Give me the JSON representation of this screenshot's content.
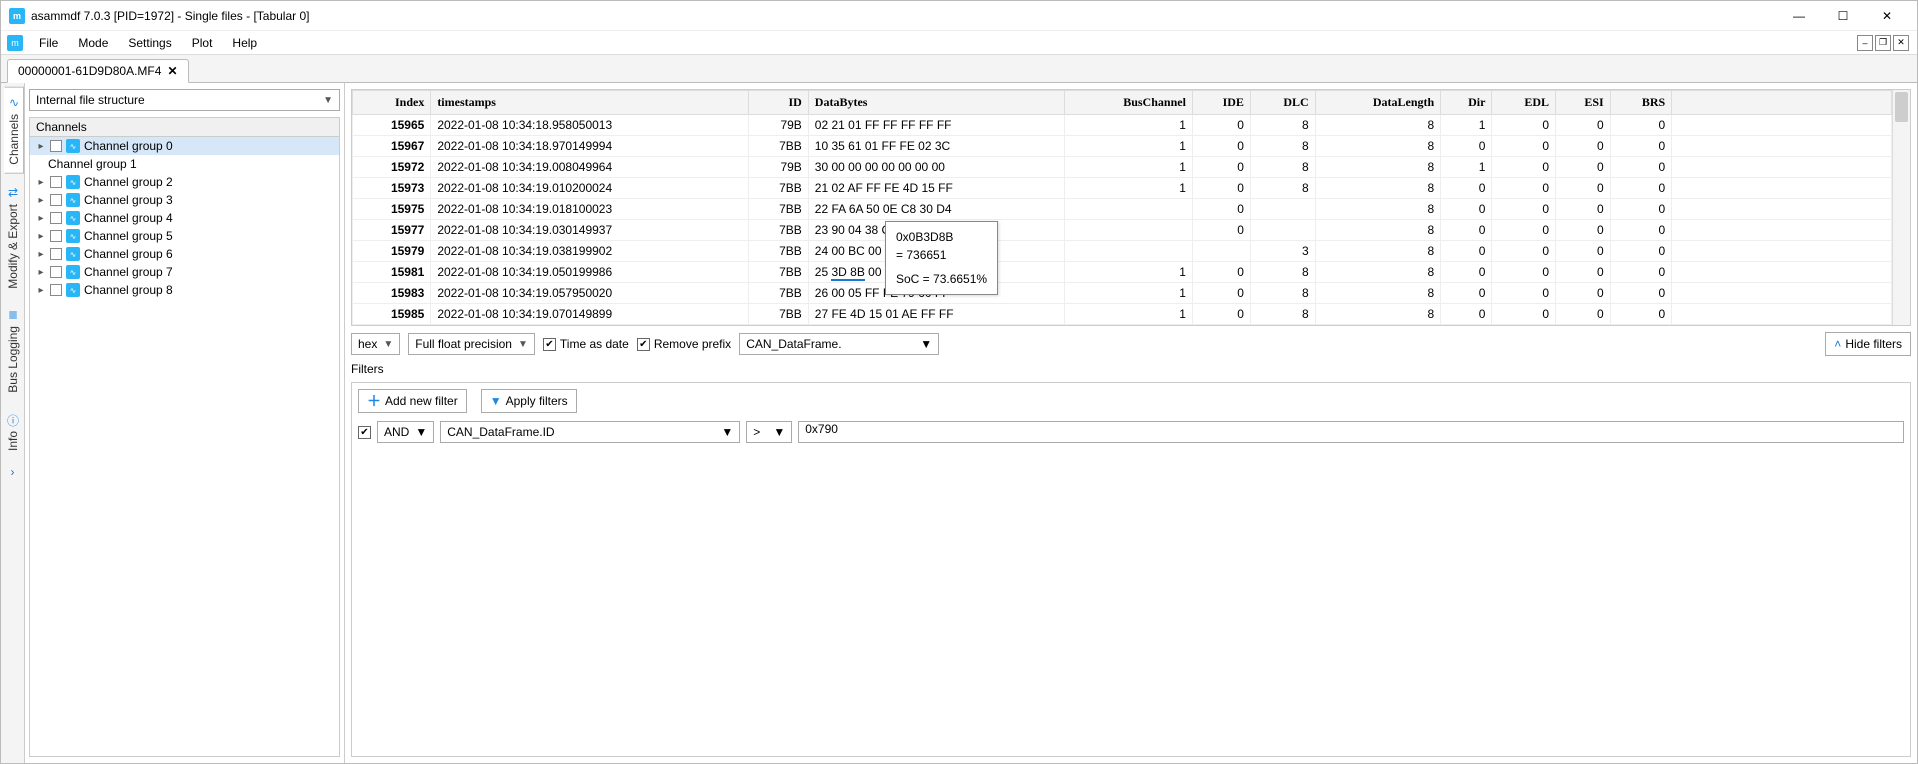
{
  "window": {
    "title": "asammdf 7.0.3 [PID=1972] - Single files - [Tabular 0]"
  },
  "menu": {
    "file": "File",
    "mode": "Mode",
    "settings": "Settings",
    "plot": "Plot",
    "help": "Help"
  },
  "filetab": {
    "name": "00000001-61D9D80A.MF4"
  },
  "sidetabs": {
    "channels": "Channels",
    "modify": "Modify & Export",
    "bus": "Bus Logging",
    "info": "Info"
  },
  "tree": {
    "combo": "Internal file structure",
    "header": "Channels",
    "groups": [
      "Channel group 0",
      "Channel group 1",
      "Channel group 2",
      "Channel group 3",
      "Channel group 4",
      "Channel group 5",
      "Channel group 6",
      "Channel group 7",
      "Channel group 8"
    ]
  },
  "table": {
    "headers": {
      "index": "Index",
      "timestamps": "timestamps",
      "id": "ID",
      "databytes": "DataBytes",
      "buschannel": "BusChannel",
      "ide": "IDE",
      "dlc": "DLC",
      "datalength": "DataLength",
      "dir": "Dir",
      "edl": "EDL",
      "esi": "ESI",
      "brs": "BRS"
    },
    "rows": [
      {
        "idx": "15965",
        "ts": "2022-01-08 10:34:18.958050013",
        "id": "79B",
        "db": "02 21 01 FF FF FF FF FF",
        "bc": "1",
        "ide": "0",
        "dlc": "8",
        "dl": "8",
        "dir": "1",
        "edl": "0",
        "esi": "0",
        "brs": "0"
      },
      {
        "idx": "15967",
        "ts": "2022-01-08 10:34:18.970149994",
        "id": "7BB",
        "db": "10 35 61 01 FF FE 02 3C",
        "bc": "1",
        "ide": "0",
        "dlc": "8",
        "dl": "8",
        "dir": "0",
        "edl": "0",
        "esi": "0",
        "brs": "0"
      },
      {
        "idx": "15972",
        "ts": "2022-01-08 10:34:19.008049964",
        "id": "79B",
        "db": "30 00 00 00 00 00 00 00",
        "bc": "1",
        "ide": "0",
        "dlc": "8",
        "dl": "8",
        "dir": "1",
        "edl": "0",
        "esi": "0",
        "brs": "0"
      },
      {
        "idx": "15973",
        "ts": "2022-01-08 10:34:19.010200024",
        "id": "7BB",
        "db": "21 02 AF FF FE 4D 15 FF",
        "bc": "1",
        "ide": "0",
        "dlc": "8",
        "dl": "8",
        "dir": "0",
        "edl": "0",
        "esi": "0",
        "brs": "0"
      },
      {
        "idx": "15975",
        "ts": "2022-01-08 10:34:19.018100023",
        "id": "7BB",
        "db": "22 FA 6A 50 0E C8 30 D4",
        "bc": "",
        "ide": "0",
        "dlc": "",
        "dl": "8",
        "dir": "0",
        "edl": "0",
        "esi": "0",
        "brs": "0"
      },
      {
        "idx": "15977",
        "ts": "2022-01-08 10:34:19.030149937",
        "id": "7BB",
        "db": "23 90 04 38 CF 03 88 00",
        "bc": "",
        "ide": "0",
        "dlc": "",
        "dl": "8",
        "dir": "0",
        "edl": "0",
        "esi": "0",
        "brs": "0"
      },
      {
        "idx": "15979",
        "ts": "2022-01-08 10:34:19.038199902",
        "id": "7BB",
        "db": "24 00 BC 00 29 15 00 ",
        "db_tail": "0B",
        "bc": "",
        "ide": "",
        "dlc": "3",
        "dl": "8",
        "dir": "0",
        "edl": "0",
        "esi": "0",
        "brs": "0"
      },
      {
        "idx": "15981",
        "ts": "2022-01-08 10:34:19.050199986",
        "id": "7BB",
        "db": "25 ",
        "db_mid": "3D 8B",
        "db_rest": " 00 10 A4 01 80",
        "bc": "1",
        "ide": "0",
        "dlc": "8",
        "dl": "8",
        "dir": "0",
        "edl": "0",
        "esi": "0",
        "brs": "0"
      },
      {
        "idx": "15983",
        "ts": "2022-01-08 10:34:19.057950020",
        "id": "7BB",
        "db": "26 00 05 FF FE 79 60 FF",
        "bc": "1",
        "ide": "0",
        "dlc": "8",
        "dl": "8",
        "dir": "0",
        "edl": "0",
        "esi": "0",
        "brs": "0"
      },
      {
        "idx": "15985",
        "ts": "2022-01-08 10:34:19.070149899",
        "id": "7BB",
        "db": "27 FE 4D 15 01 AE FF FF",
        "bc": "1",
        "ide": "0",
        "dlc": "8",
        "dl": "8",
        "dir": "0",
        "edl": "0",
        "esi": "0",
        "brs": "0"
      }
    ]
  },
  "tooltip": {
    "line1": "0x0B3D8B",
    "line2": "= 736651",
    "line3": "SoC = 73.6651%"
  },
  "controls": {
    "format": "hex",
    "precision": "Full float precision",
    "timeasdate": "Time as date",
    "removeprefix": "Remove prefix",
    "prefixvalue": "CAN_DataFrame.",
    "hidefilters": "Hide filters"
  },
  "filters": {
    "label": "Filters",
    "addnew": "Add new filter",
    "apply": "Apply filters",
    "row": {
      "logic": "AND",
      "field": "CAN_DataFrame.ID",
      "op": ">",
      "value": "0x790"
    }
  }
}
